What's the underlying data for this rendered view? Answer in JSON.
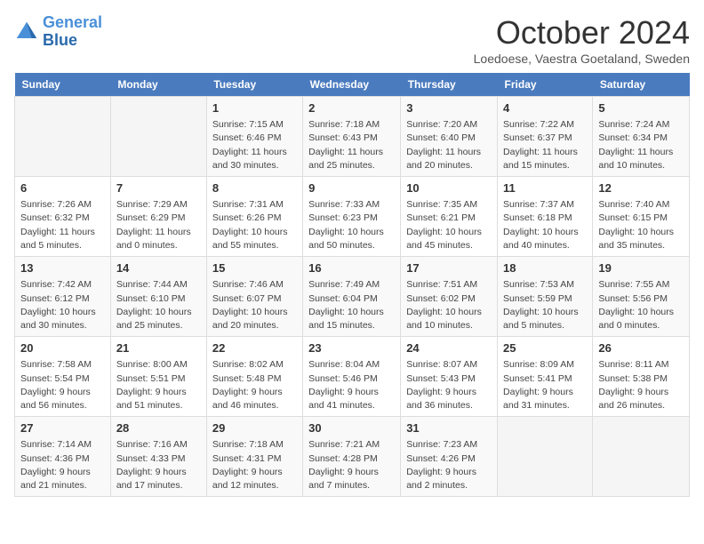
{
  "header": {
    "logo_general": "General",
    "logo_blue": "Blue",
    "month_title": "October 2024",
    "location": "Loedoese, Vaestra Goetaland, Sweden"
  },
  "weekdays": [
    "Sunday",
    "Monday",
    "Tuesday",
    "Wednesday",
    "Thursday",
    "Friday",
    "Saturday"
  ],
  "weeks": [
    [
      {
        "day": "",
        "info": ""
      },
      {
        "day": "",
        "info": ""
      },
      {
        "day": "1",
        "info": "Sunrise: 7:15 AM\nSunset: 6:46 PM\nDaylight: 11 hours\nand 30 minutes."
      },
      {
        "day": "2",
        "info": "Sunrise: 7:18 AM\nSunset: 6:43 PM\nDaylight: 11 hours\nand 25 minutes."
      },
      {
        "day": "3",
        "info": "Sunrise: 7:20 AM\nSunset: 6:40 PM\nDaylight: 11 hours\nand 20 minutes."
      },
      {
        "day": "4",
        "info": "Sunrise: 7:22 AM\nSunset: 6:37 PM\nDaylight: 11 hours\nand 15 minutes."
      },
      {
        "day": "5",
        "info": "Sunrise: 7:24 AM\nSunset: 6:34 PM\nDaylight: 11 hours\nand 10 minutes."
      }
    ],
    [
      {
        "day": "6",
        "info": "Sunrise: 7:26 AM\nSunset: 6:32 PM\nDaylight: 11 hours\nand 5 minutes."
      },
      {
        "day": "7",
        "info": "Sunrise: 7:29 AM\nSunset: 6:29 PM\nDaylight: 11 hours\nand 0 minutes."
      },
      {
        "day": "8",
        "info": "Sunrise: 7:31 AM\nSunset: 6:26 PM\nDaylight: 10 hours\nand 55 minutes."
      },
      {
        "day": "9",
        "info": "Sunrise: 7:33 AM\nSunset: 6:23 PM\nDaylight: 10 hours\nand 50 minutes."
      },
      {
        "day": "10",
        "info": "Sunrise: 7:35 AM\nSunset: 6:21 PM\nDaylight: 10 hours\nand 45 minutes."
      },
      {
        "day": "11",
        "info": "Sunrise: 7:37 AM\nSunset: 6:18 PM\nDaylight: 10 hours\nand 40 minutes."
      },
      {
        "day": "12",
        "info": "Sunrise: 7:40 AM\nSunset: 6:15 PM\nDaylight: 10 hours\nand 35 minutes."
      }
    ],
    [
      {
        "day": "13",
        "info": "Sunrise: 7:42 AM\nSunset: 6:12 PM\nDaylight: 10 hours\nand 30 minutes."
      },
      {
        "day": "14",
        "info": "Sunrise: 7:44 AM\nSunset: 6:10 PM\nDaylight: 10 hours\nand 25 minutes."
      },
      {
        "day": "15",
        "info": "Sunrise: 7:46 AM\nSunset: 6:07 PM\nDaylight: 10 hours\nand 20 minutes."
      },
      {
        "day": "16",
        "info": "Sunrise: 7:49 AM\nSunset: 6:04 PM\nDaylight: 10 hours\nand 15 minutes."
      },
      {
        "day": "17",
        "info": "Sunrise: 7:51 AM\nSunset: 6:02 PM\nDaylight: 10 hours\nand 10 minutes."
      },
      {
        "day": "18",
        "info": "Sunrise: 7:53 AM\nSunset: 5:59 PM\nDaylight: 10 hours\nand 5 minutes."
      },
      {
        "day": "19",
        "info": "Sunrise: 7:55 AM\nSunset: 5:56 PM\nDaylight: 10 hours\nand 0 minutes."
      }
    ],
    [
      {
        "day": "20",
        "info": "Sunrise: 7:58 AM\nSunset: 5:54 PM\nDaylight: 9 hours\nand 56 minutes."
      },
      {
        "day": "21",
        "info": "Sunrise: 8:00 AM\nSunset: 5:51 PM\nDaylight: 9 hours\nand 51 minutes."
      },
      {
        "day": "22",
        "info": "Sunrise: 8:02 AM\nSunset: 5:48 PM\nDaylight: 9 hours\nand 46 minutes."
      },
      {
        "day": "23",
        "info": "Sunrise: 8:04 AM\nSunset: 5:46 PM\nDaylight: 9 hours\nand 41 minutes."
      },
      {
        "day": "24",
        "info": "Sunrise: 8:07 AM\nSunset: 5:43 PM\nDaylight: 9 hours\nand 36 minutes."
      },
      {
        "day": "25",
        "info": "Sunrise: 8:09 AM\nSunset: 5:41 PM\nDaylight: 9 hours\nand 31 minutes."
      },
      {
        "day": "26",
        "info": "Sunrise: 8:11 AM\nSunset: 5:38 PM\nDaylight: 9 hours\nand 26 minutes."
      }
    ],
    [
      {
        "day": "27",
        "info": "Sunrise: 7:14 AM\nSunset: 4:36 PM\nDaylight: 9 hours\nand 21 minutes."
      },
      {
        "day": "28",
        "info": "Sunrise: 7:16 AM\nSunset: 4:33 PM\nDaylight: 9 hours\nand 17 minutes."
      },
      {
        "day": "29",
        "info": "Sunrise: 7:18 AM\nSunset: 4:31 PM\nDaylight: 9 hours\nand 12 minutes."
      },
      {
        "day": "30",
        "info": "Sunrise: 7:21 AM\nSunset: 4:28 PM\nDaylight: 9 hours\nand 7 minutes."
      },
      {
        "day": "31",
        "info": "Sunrise: 7:23 AM\nSunset: 4:26 PM\nDaylight: 9 hours\nand 2 minutes."
      },
      {
        "day": "",
        "info": ""
      },
      {
        "day": "",
        "info": ""
      }
    ]
  ]
}
